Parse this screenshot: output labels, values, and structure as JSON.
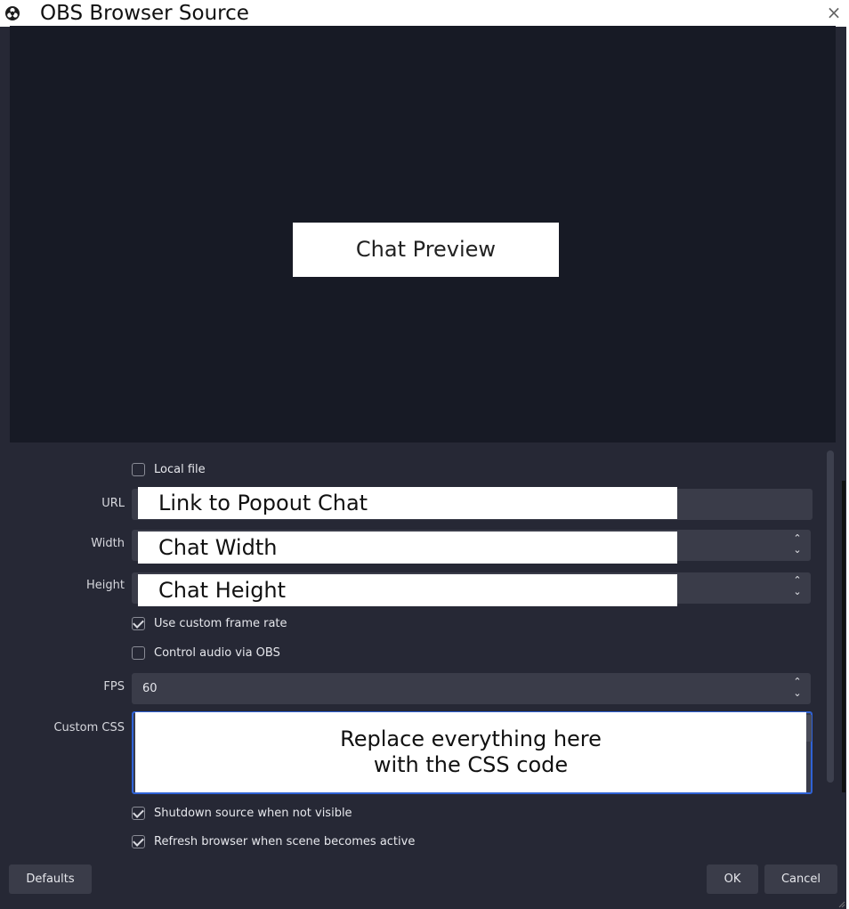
{
  "window": {
    "title": "OBS Browser Source",
    "close_glyph": "×",
    "icon": "obs-logo-icon"
  },
  "preview": {
    "label": "Chat Preview"
  },
  "local_file": {
    "label": "Local file",
    "checked": false
  },
  "url": {
    "label": "URL",
    "overlay": "Link to Popout Chat"
  },
  "width": {
    "label": "Width",
    "overlay": "Chat Width"
  },
  "height": {
    "label": "Height",
    "overlay": "Chat Height"
  },
  "custom_frame_rate": {
    "label": "Use custom frame rate",
    "checked": true
  },
  "control_audio": {
    "label": "Control audio via OBS",
    "checked": false
  },
  "fps": {
    "label": "FPS",
    "value": "60"
  },
  "custom_css": {
    "label": "Custom CSS",
    "overlay_line1": "Replace everything here",
    "overlay_line2": "with the CSS code"
  },
  "shutdown": {
    "label": "Shutdown source when not visible",
    "checked": true
  },
  "refresh": {
    "label": "Refresh browser when scene becomes active",
    "checked": true
  },
  "buttons": {
    "defaults": "Defaults",
    "ok": "OK",
    "cancel": "Cancel"
  },
  "spinner": {
    "up": "⌃",
    "down": "⌄"
  },
  "colors": {
    "dialog_bg": "#262835",
    "preview_bg": "#171a25",
    "field_bg": "#3a3c49",
    "focus_border": "#2f62d6"
  }
}
